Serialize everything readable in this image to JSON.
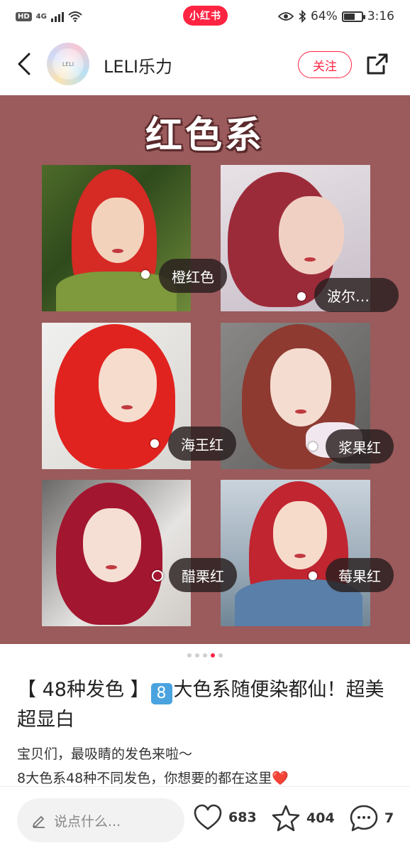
{
  "status_bar": {
    "hd": "HD",
    "network": "4G",
    "app_pill": "小红书",
    "battery_text": "64%",
    "battery_level": 0.64,
    "time": "3:16"
  },
  "header": {
    "author_name": "LELI乐力",
    "follow_label": "关注",
    "icons": [
      "back-arrow-icon",
      "share-icon"
    ]
  },
  "slide": {
    "title": "红色系",
    "tags": [
      "橙红色",
      "波尔…",
      "海王红",
      "浆果红",
      "醋栗红",
      "莓果红"
    ],
    "page_count": 5,
    "current_page": 4
  },
  "note": {
    "title_prefix": "【 48种发色 】",
    "title_badge": "8",
    "title_rest": "大色系随便染都仙！超美超显白",
    "body_line1": "宝贝们，最吸睛的发色来啦～",
    "body_line2": "8大色系48种不同发色，你想要的都在这里",
    "body_emoji": "❤️"
  },
  "bottom_bar": {
    "comment_placeholder": "说点什么...",
    "like_count": "683",
    "collect_count": "404",
    "comment_count": "7"
  },
  "colors": {
    "brand": "#ff2442",
    "slide_bg": "#9b5a5b"
  }
}
